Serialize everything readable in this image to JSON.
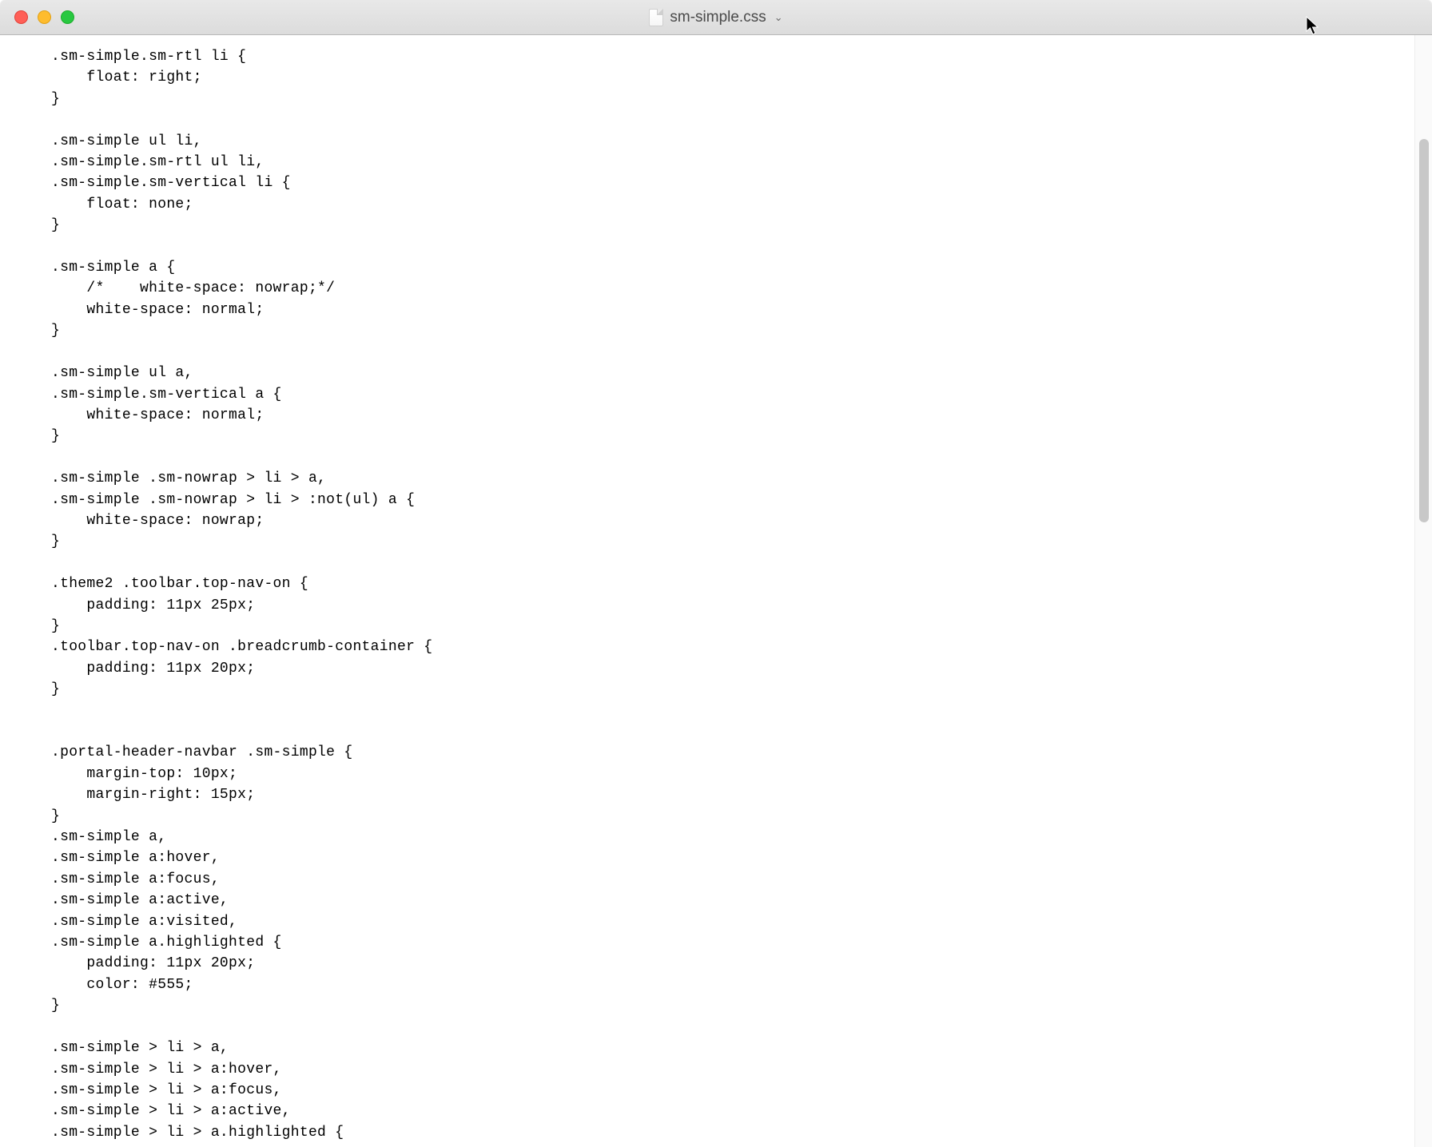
{
  "titlebar": {
    "filename": "sm-simple.css",
    "dropdown_glyph": "⌄"
  },
  "traffic_lights": {
    "close": "close",
    "minimize": "minimize",
    "maximize": "maximize"
  },
  "code_lines": [
    ".sm-simple.sm-rtl li {",
    "    float: right;",
    "}",
    "",
    ".sm-simple ul li,",
    ".sm-simple.sm-rtl ul li,",
    ".sm-simple.sm-vertical li {",
    "    float: none;",
    "}",
    "",
    ".sm-simple a {",
    "    /*    white-space: nowrap;*/",
    "    white-space: normal;",
    "}",
    "",
    ".sm-simple ul a,",
    ".sm-simple.sm-vertical a {",
    "    white-space: normal;",
    "}",
    "",
    ".sm-simple .sm-nowrap > li > a,",
    ".sm-simple .sm-nowrap > li > :not(ul) a {",
    "    white-space: nowrap;",
    "}",
    "",
    ".theme2 .toolbar.top-nav-on {",
    "    padding: 11px 25px;",
    "}",
    ".toolbar.top-nav-on .breadcrumb-container {",
    "    padding: 11px 20px;",
    "}",
    "",
    "",
    ".portal-header-navbar .sm-simple {",
    "    margin-top: 10px;",
    "    margin-right: 15px;",
    "}",
    ".sm-simple a,",
    ".sm-simple a:hover,",
    ".sm-simple a:focus,",
    ".sm-simple a:active,",
    ".sm-simple a:visited,",
    ".sm-simple a.highlighted {",
    "    padding: 11px 20px;",
    "    color: #555;",
    "}",
    "",
    ".sm-simple > li > a,",
    ".sm-simple > li > a:hover,",
    ".sm-simple > li > a:focus,",
    ".sm-simple > li > a:active,",
    ".sm-simple > li > a.highlighted {"
  ]
}
